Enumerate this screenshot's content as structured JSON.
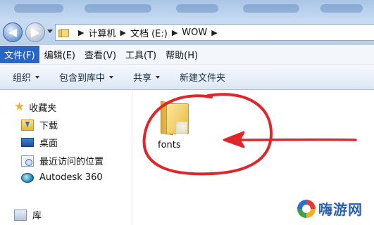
{
  "address_bar": {
    "crumbs": [
      "计算机",
      "文档 (E:)",
      "WOW"
    ]
  },
  "menu": {
    "items": [
      "文件(F)",
      "编辑(E)",
      "查看(V)",
      "工具(T)",
      "帮助(H)"
    ]
  },
  "toolbar": {
    "organize": "组织",
    "include_in_library": "包含到库中",
    "share": "共享",
    "new_folder": "新建文件夹"
  },
  "nav_pane": {
    "favorites": "收藏夹",
    "items": [
      "下载",
      "桌面",
      "最近访问的位置",
      "Autodesk 360"
    ],
    "library": "库"
  },
  "content": {
    "folder_name": "fonts"
  },
  "annotation": {
    "color": "#e0262a"
  },
  "watermark": {
    "text": "嗨游网"
  }
}
